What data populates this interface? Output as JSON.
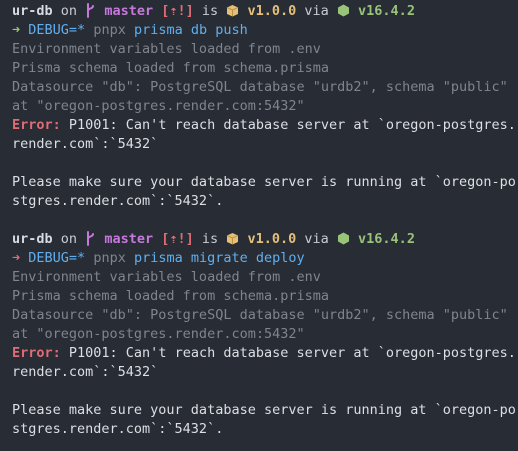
{
  "blocks": [
    {
      "prompt": {
        "dir": "ur-db",
        "on": "on",
        "branch": "master",
        "git_status": "[⇡!]",
        "is": "is",
        "package_version": "v1.0.0",
        "via": "via",
        "node_version": "v16.4.2",
        "arrow_status": "success"
      },
      "command": {
        "env": "DEBUG=*",
        "runner": "pnpx",
        "args": "prisma db push"
      },
      "output": [
        "Environment variables loaded from .env",
        "Prisma schema loaded from schema.prisma",
        "Datasource \"db\": PostgreSQL database \"urdb2\", schema \"public\"",
        "at \"oregon-postgres.render.com:5432\""
      ],
      "error": {
        "label": "Error:",
        "line1": " P1001: Can't reach database server at `oregon-postgres.",
        "line2": "render.com`:`5432`"
      },
      "hint": {
        "line1": "Please make sure your database server is running at `oregon-po",
        "line2": "stgres.render.com`:`5432`."
      }
    },
    {
      "prompt": {
        "dir": "ur-db",
        "on": "on",
        "branch": "master",
        "git_status": "[⇡!]",
        "is": "is",
        "package_version": "v1.0.0",
        "via": "via",
        "node_version": "v16.4.2",
        "arrow_status": "error"
      },
      "command": {
        "env": "DEBUG=*",
        "runner": "pnpx",
        "args": "prisma migrate deploy"
      },
      "output": [
        "Environment variables loaded from .env",
        "Prisma schema loaded from schema.prisma",
        "Datasource \"db\": PostgreSQL database \"urdb2\", schema \"public\"",
        "at \"oregon-postgres.render.com:5432\""
      ],
      "error": {
        "label": "Error:",
        "line1": " P1001: Can't reach database server at `oregon-postgres.",
        "line2": "render.com`:`5432`"
      },
      "hint": {
        "line1": "Please make sure your database server is running at `oregon-po",
        "line2": "stgres.render.com`:`5432`."
      }
    }
  ],
  "icons": {
    "branch": "git-branch-icon",
    "package": "package-box-icon",
    "node": "nodejs-hexagon-icon",
    "prompt_arrow": "right-arrow-icon"
  },
  "colors": {
    "background": "#282c34",
    "foreground": "#dcdfe4",
    "branch": "#c678dd",
    "status": "#e06c75",
    "package": "#e5c07b",
    "node": "#98c379",
    "command": "#61afef",
    "dim": "#7f848e",
    "error": "#e06c75"
  }
}
